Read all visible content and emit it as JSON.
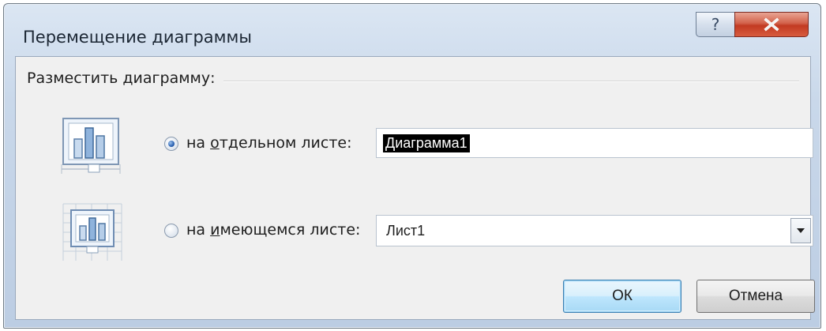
{
  "window": {
    "title": "Перемещение диаграммы",
    "help_glyph": "?",
    "close_glyph": "x"
  },
  "group": {
    "label": "Разместить диаграмму:"
  },
  "options": [
    {
      "label_prefix": "на ",
      "label_accel": "о",
      "label_rest": "тдельном листе:",
      "selected": true,
      "input_value": "Диаграмма1"
    },
    {
      "label_prefix": "на ",
      "label_accel": "и",
      "label_rest": "меющемся листе:",
      "selected": false,
      "select_value": "Лист1"
    }
  ],
  "buttons": {
    "ok": "ОК",
    "cancel": "Отмена"
  },
  "colors": {
    "accent_blue": "#2a62b3",
    "close_red": "#c23a22",
    "titlebar": "#c9d8ea"
  }
}
